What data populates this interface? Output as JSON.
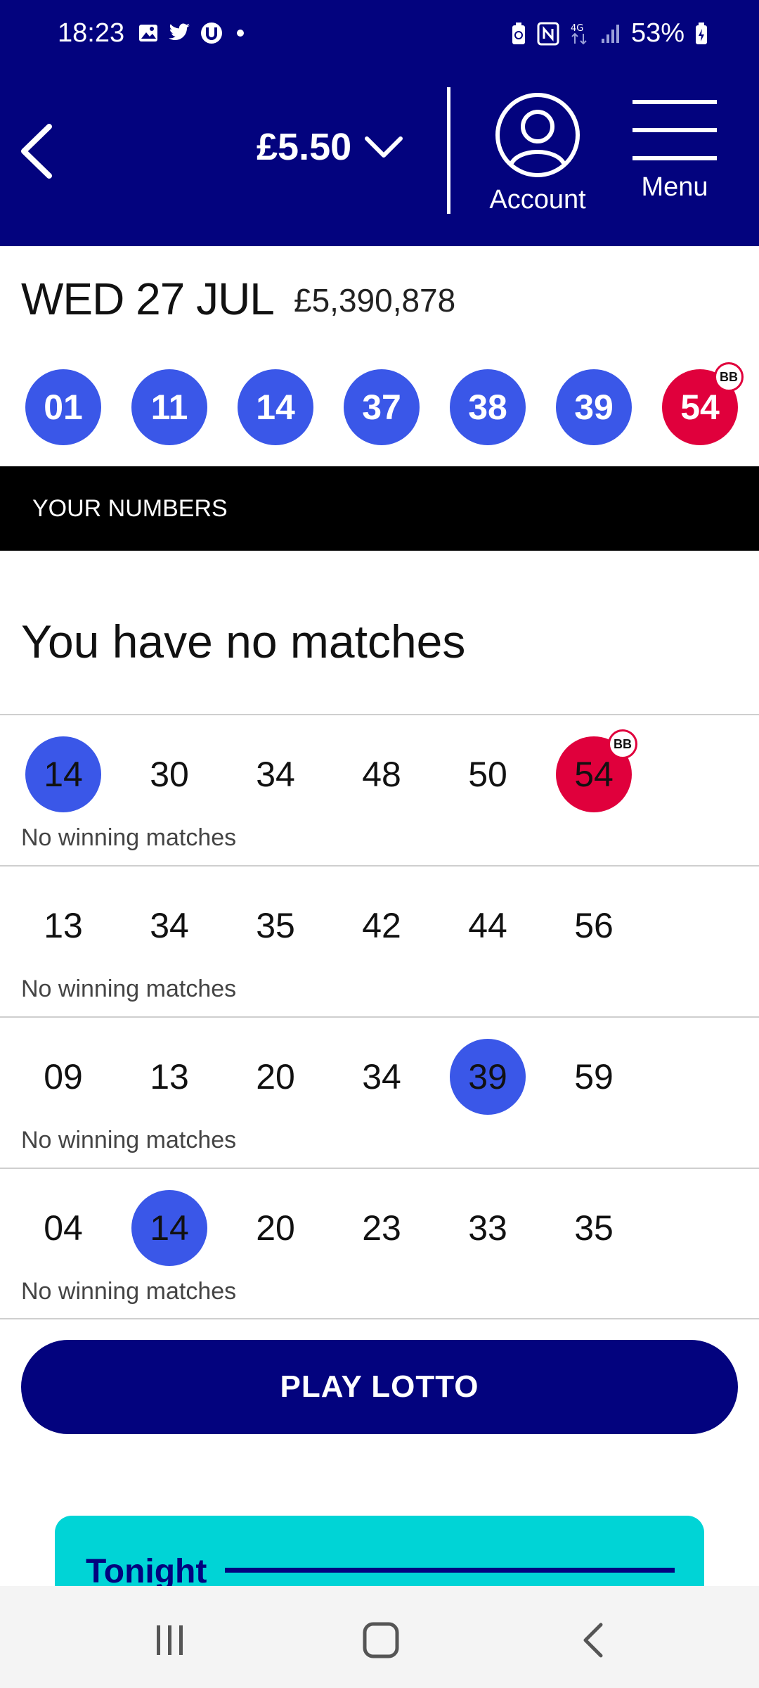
{
  "status_bar": {
    "time": "18:23",
    "battery_percent": "53%"
  },
  "header": {
    "balance": "£5.50",
    "account_label": "Account",
    "menu_label": "Menu"
  },
  "draw": {
    "date": "WED 27 JUL",
    "jackpot": "£5,390,878",
    "numbers": [
      "01",
      "11",
      "14",
      "37",
      "38",
      "39"
    ],
    "bonus": "54",
    "bonus_badge": "BB"
  },
  "section_title": "YOUR NUMBERS",
  "summary": "You have no matches",
  "lines": [
    {
      "numbers": [
        "14",
        "30",
        "34",
        "48",
        "50",
        "54"
      ],
      "matched_index": [
        0
      ],
      "bonus_index": 5,
      "status": "No winning matches"
    },
    {
      "numbers": [
        "13",
        "34",
        "35",
        "42",
        "44",
        "56"
      ],
      "matched_index": [],
      "bonus_index": null,
      "status": "No winning matches"
    },
    {
      "numbers": [
        "09",
        "13",
        "20",
        "34",
        "39",
        "59"
      ],
      "matched_index": [
        4
      ],
      "bonus_index": null,
      "status": "No winning matches"
    },
    {
      "numbers": [
        "04",
        "14",
        "20",
        "23",
        "33",
        "35"
      ],
      "matched_index": [
        1
      ],
      "bonus_index": null,
      "status": "No winning matches"
    }
  ],
  "play_button": "PLAY LOTTO",
  "promo": {
    "title": "Tonight"
  },
  "colors": {
    "brand_navy": "#03037e",
    "ball_blue": "#3a57e8",
    "bonus_red": "#e0003c",
    "promo_cyan": "#00d4d6"
  }
}
